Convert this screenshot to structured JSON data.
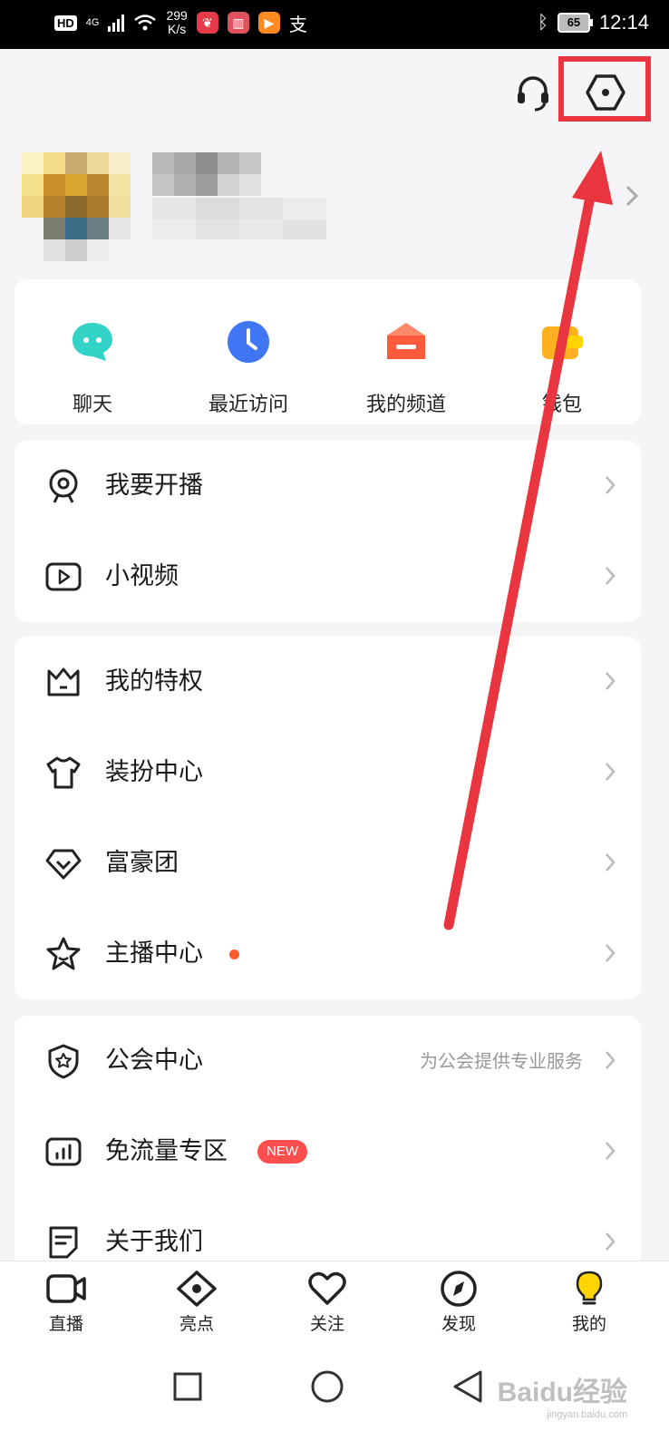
{
  "status_bar": {
    "hd": "HD",
    "network": "4G",
    "speed_value": "299",
    "speed_unit": "K/s",
    "battery": "65",
    "time": "12:14"
  },
  "header": {
    "service_icon": "headset-icon",
    "settings_icon": "hexagon-settings-icon"
  },
  "quick_actions": [
    {
      "label": "聊天",
      "icon": "chat-bubble-icon",
      "color": "#33d3c7"
    },
    {
      "label": "最近访问",
      "icon": "clock-icon",
      "color": "#4a63f5"
    },
    {
      "label": "我的频道",
      "icon": "channel-house-icon",
      "color": "#ff5a3c"
    },
    {
      "label": "钱包",
      "icon": "wallet-icon",
      "color": "#ffb020"
    }
  ],
  "menu_group1": [
    {
      "label": "我要开播",
      "icon": "webcam-icon"
    },
    {
      "label": "小视频",
      "icon": "video-play-icon"
    }
  ],
  "menu_group2": [
    {
      "label": "我的特权",
      "icon": "crown-icon"
    },
    {
      "label": "装扮中心",
      "icon": "tshirt-icon"
    },
    {
      "label": "富豪团",
      "icon": "diamond-icon"
    },
    {
      "label": "主播中心",
      "icon": "star-icon",
      "has_dot": true
    }
  ],
  "menu_group3": [
    {
      "label": "公会中心",
      "icon": "shield-star-icon",
      "hint": "为公会提供专业服务"
    },
    {
      "label": "免流量专区",
      "icon": "bar-chart-icon",
      "badge": "NEW"
    },
    {
      "label": "关于我们",
      "icon": "note-icon"
    }
  ],
  "tabbar": [
    {
      "label": "直播",
      "icon": "video-camera-icon"
    },
    {
      "label": "亮点",
      "icon": "eye-diamond-icon"
    },
    {
      "label": "关注",
      "icon": "heart-icon"
    },
    {
      "label": "发现",
      "icon": "compass-icon"
    },
    {
      "label": "我的",
      "icon": "lightbulb-icon",
      "active": true
    }
  ],
  "watermark": {
    "brand": "Baidu经验",
    "url": "jingyan.baidu.com"
  },
  "colors": {
    "annotation_red": "#e8353f",
    "accent_yellow": "#ffd500",
    "dot_orange": "#ff5a2c"
  }
}
